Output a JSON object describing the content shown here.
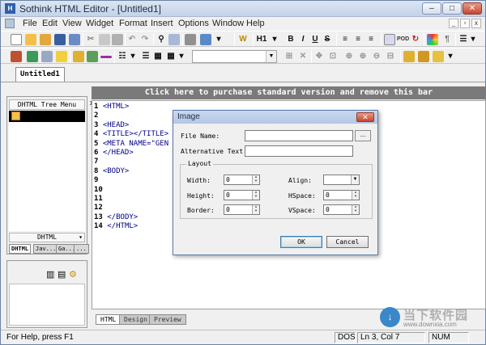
{
  "window": {
    "app_icon": "html-editor-icon",
    "title": "Sothink HTML Editor - [Untitled1]",
    "controls": [
      "minimize",
      "maximize",
      "close"
    ]
  },
  "menu": {
    "items": [
      "File",
      "Edit",
      "View",
      "Widget",
      "Format",
      "Insert",
      "Options",
      "Window",
      "Help"
    ],
    "mdi_controls": [
      "minimize",
      "restore",
      "close"
    ]
  },
  "toolbar1": {
    "heading_label": "H1",
    "bold": "B",
    "italic": "I",
    "underline": "U",
    "strike": "S",
    "pod": "POD",
    "pilcrow": "¶"
  },
  "document_tab": "Untitled1",
  "left_panel": {
    "header": "DHTML Tree Menu",
    "bottom_label": "DHTML",
    "tabs": [
      "DHTML",
      "Jav...",
      "Ga...",
      "..."
    ]
  },
  "banner": "Click here to purchase standard version and remove this bar",
  "code": [
    {
      "n": "1",
      "text": "<HTML>"
    },
    {
      "n": "2",
      "text": ""
    },
    {
      "n": "3",
      "text": "<HEAD>"
    },
    {
      "n": "4",
      "text": "<TITLE></TITLE>"
    },
    {
      "n": "5",
      "text": "<META NAME=\"GEN"
    },
    {
      "n": "6",
      "text": "</HEAD>"
    },
    {
      "n": "7",
      "text": ""
    },
    {
      "n": "8",
      "text": "<BODY>"
    },
    {
      "n": "9",
      "text": ""
    },
    {
      "n": "10",
      "text": ""
    },
    {
      "n": "11",
      "text": ""
    },
    {
      "n": "12",
      "text": ""
    },
    {
      "n": "13",
      "text": "</BODY>"
    },
    {
      "n": "14",
      "text": "</HTML>"
    }
  ],
  "editor_tabs": [
    "HTML",
    "Design",
    "Preview"
  ],
  "dialog": {
    "title": "Image",
    "file_name_label": "File Name:",
    "alt_text_label": "Alternative Text:",
    "browse_label": "...",
    "layout_label": "Layout",
    "width_label": "Width:",
    "width_value": "0",
    "height_label": "Height:",
    "height_value": "0",
    "border_label": "Border:",
    "border_value": "0",
    "align_label": "Align:",
    "hspace_label": "HSpace:",
    "hspace_value": "0",
    "vspace_label": "VSpace:",
    "vspace_value": "0",
    "ok": "OK",
    "cancel": "Cancel"
  },
  "status": {
    "help": "For Help, press F1",
    "dos": "DOS",
    "position": "Ln 3, Col 7",
    "num": "NUM"
  },
  "watermark": {
    "text": "当下软件园",
    "url": "www.downxia.com"
  },
  "colors": {
    "tag_color": "#00008b",
    "banner_bg": "#7a7a7a"
  }
}
